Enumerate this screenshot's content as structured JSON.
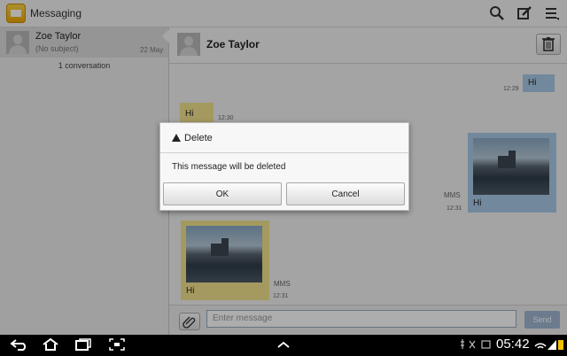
{
  "app": {
    "title": "Messaging"
  },
  "toolbar_icons": [
    "search-icon",
    "compose-icon",
    "menu-icon"
  ],
  "conversation_list": {
    "items": [
      {
        "name": "Zoe Taylor",
        "subject": "(No subject)",
        "date": "22 May"
      }
    ],
    "count_text": "1 conversation"
  },
  "thread": {
    "contact": "Zoe Taylor",
    "messages": [
      {
        "type": "sent",
        "text": "Hi",
        "time": "12:29"
      },
      {
        "type": "received",
        "text": "Hi",
        "time": "12:30"
      },
      {
        "type": "sent",
        "text": "Hi",
        "label": "MMS",
        "time": "12:31"
      },
      {
        "type": "received",
        "text": "Hi",
        "label": "MMS",
        "time": "12:31"
      }
    ]
  },
  "compose": {
    "placeholder": "Enter message",
    "send_label": "Send"
  },
  "dialog": {
    "title": "Delete",
    "message": "This message will be deleted",
    "ok_label": "OK",
    "cancel_label": "Cancel"
  },
  "status_bar": {
    "time": "05:42"
  },
  "colors": {
    "sent_bubble": "#a9c9e6",
    "received_bubble": "#f2e48e",
    "send_button": "#9fb6d0"
  }
}
